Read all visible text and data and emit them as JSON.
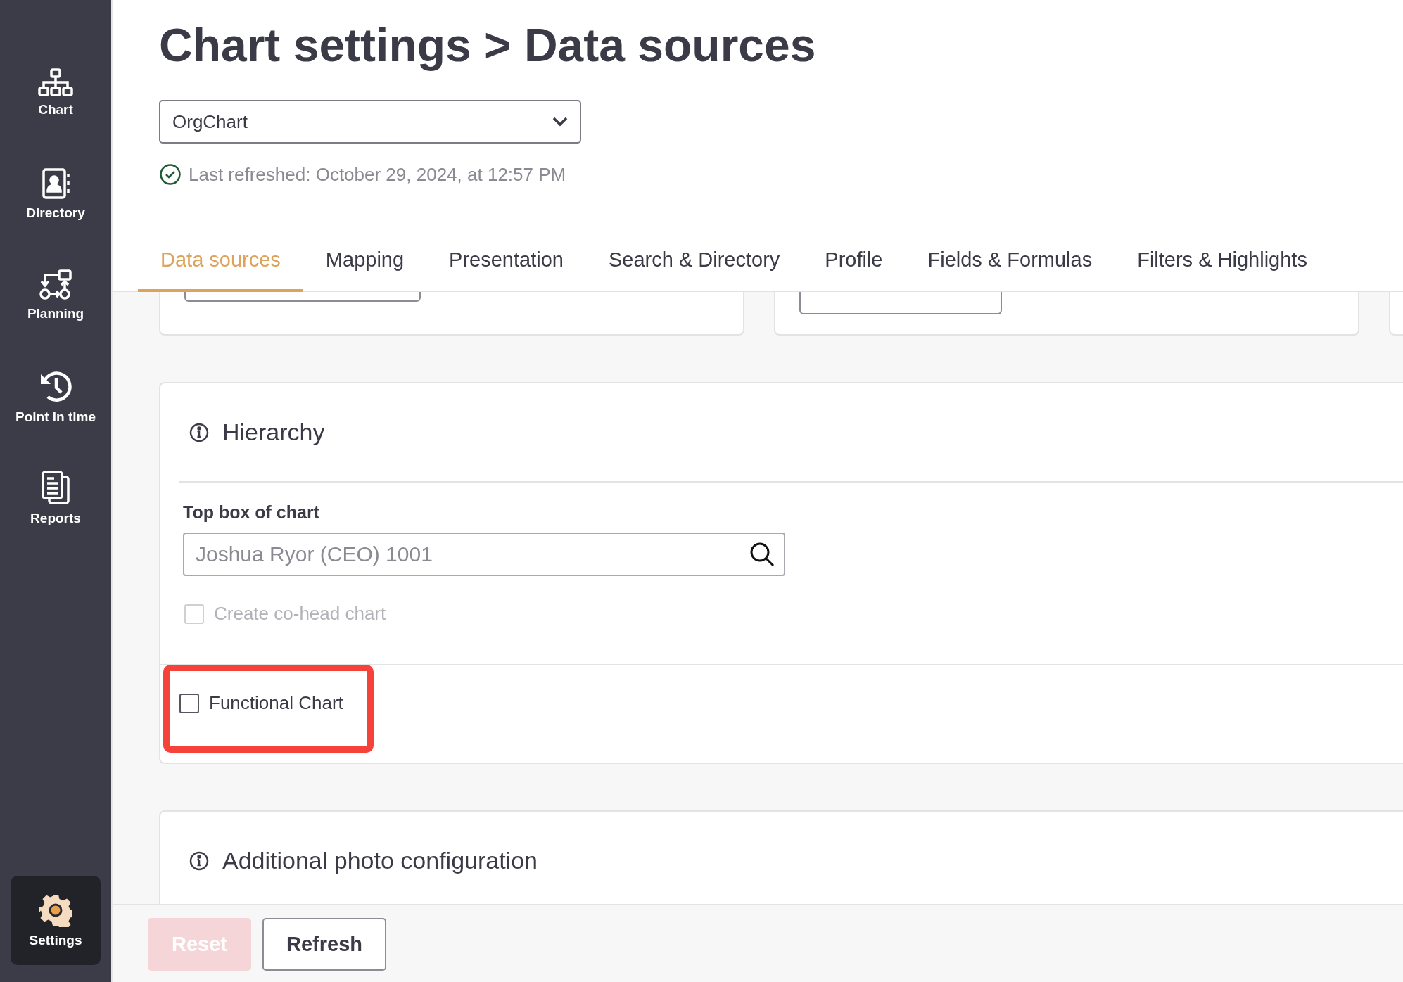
{
  "sidebar": {
    "items": [
      {
        "label": "Chart",
        "kind": "chart",
        "selected": false
      },
      {
        "label": "Directory",
        "kind": "directory",
        "selected": false
      },
      {
        "label": "Planning",
        "kind": "planning",
        "selected": false
      },
      {
        "label": "Point in time",
        "kind": "history",
        "selected": false
      },
      {
        "label": "Reports",
        "kind": "reports",
        "selected": false
      }
    ],
    "bottom_item": {
      "label": "Settings",
      "kind": "settings",
      "selected": true
    }
  },
  "title": "Chart settings > Data sources",
  "chart_select": {
    "value": "OrgChart"
  },
  "last_refreshed": "Last refreshed: October 29, 2024, at 12:57 PM",
  "tabs": [
    {
      "label": "Data sources",
      "selected": true
    },
    {
      "label": "Mapping",
      "selected": false
    },
    {
      "label": "Presentation",
      "selected": false
    },
    {
      "label": "Search & Directory",
      "selected": false
    },
    {
      "label": "Profile",
      "selected": false
    },
    {
      "label": "Fields & Formulas",
      "selected": false
    },
    {
      "label": "Filters & Highlights",
      "selected": false
    }
  ],
  "hierarchy": {
    "title": "Hierarchy",
    "top_box_label": "Top box of chart",
    "top_box_value": "Joshua Ryor (CEO) 1001",
    "co_head_checkbox": {
      "label": "Create co-head chart",
      "checked": false,
      "disabled": true,
      "highlighted": false
    },
    "functional_checkbox": {
      "label": "Functional Chart",
      "checked": false,
      "disabled": false,
      "highlighted": true
    }
  },
  "photo_section": {
    "title": "Additional photo configuration"
  },
  "footer_buttons": [
    {
      "label": "Reset",
      "disabled": true
    },
    {
      "label": "Refresh",
      "disabled": false
    }
  ]
}
